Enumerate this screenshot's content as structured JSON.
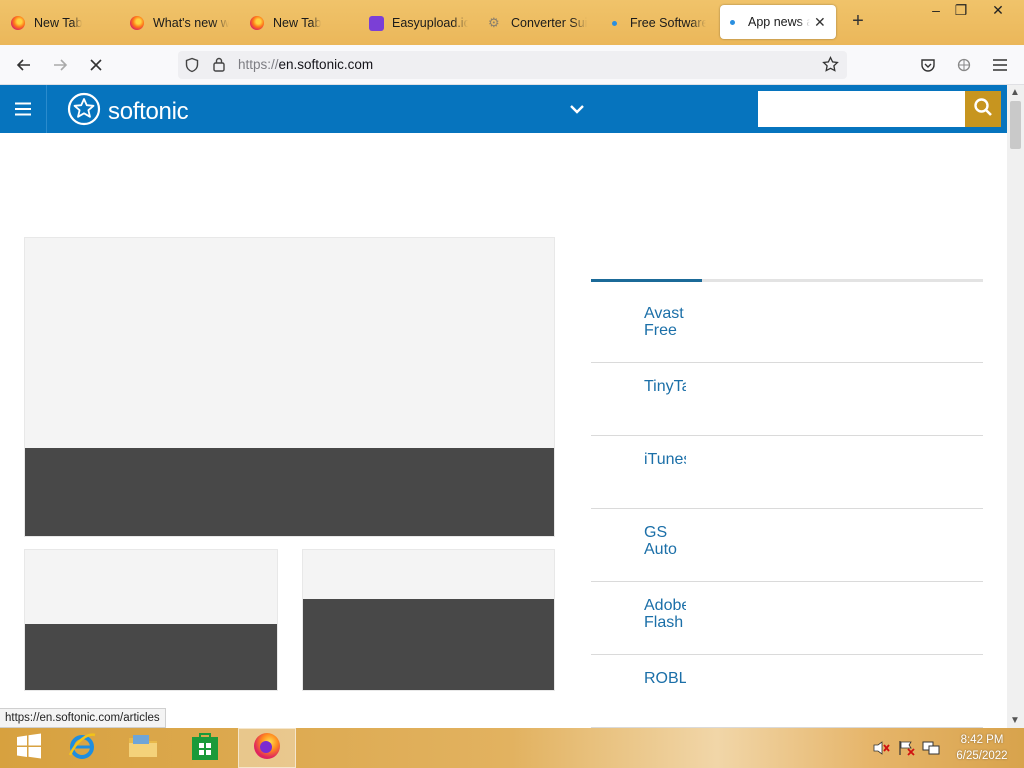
{
  "tabs": [
    {
      "label": "New Tab",
      "icon": "firefox-icon"
    },
    {
      "label": "What's new wi",
      "icon": "firefox-icon"
    },
    {
      "label": "New Tab",
      "icon": "firefox-icon"
    },
    {
      "label": "Easyupload.io",
      "icon": "easyupload-icon"
    },
    {
      "label": "Converter Suit",
      "icon": "converter-icon"
    },
    {
      "label": "Free Software",
      "icon": "loading-dot-icon"
    },
    {
      "label": "App news a",
      "icon": "loading-dot-icon",
      "active": true
    }
  ],
  "address": {
    "scheme": "https://",
    "host": "en.softonic.com"
  },
  "site": {
    "brand": "softonic",
    "search_placeholder": ""
  },
  "apps": [
    {
      "name": "Avast Free Antivirus"
    },
    {
      "name": "TinyTask"
    },
    {
      "name": "iTunes"
    },
    {
      "name": "GS Auto Clicker"
    },
    {
      "name": "Adobe Flash Player"
    },
    {
      "name": "ROBLOX"
    }
  ],
  "status_url": "https://en.softonic.com/articles",
  "clock": {
    "time": "8:42 PM",
    "date": "6/25/2022"
  },
  "colors": {
    "site_header": "#0674be",
    "search_button": "#c7951f",
    "link": "#1b6fa8"
  }
}
